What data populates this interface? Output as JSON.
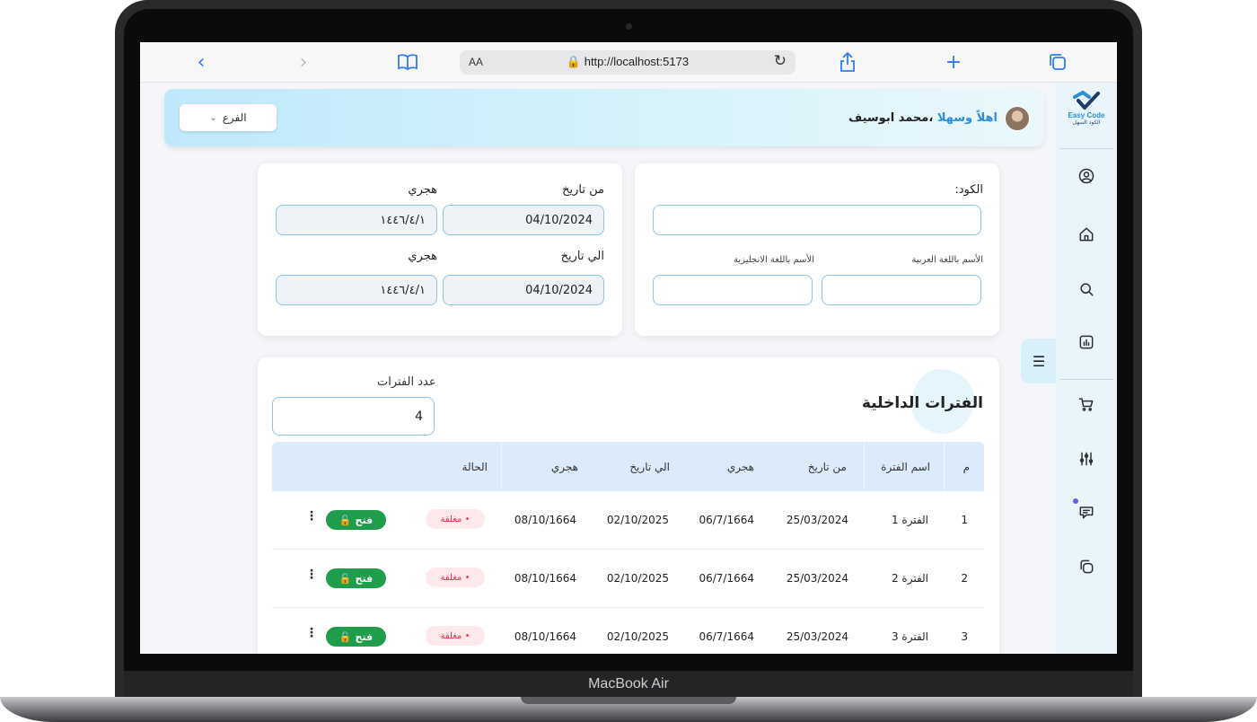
{
  "device": {
    "brand": "MacBook Air"
  },
  "browser": {
    "text_size_label": "AA",
    "url": "http://localhost:5173"
  },
  "app": {
    "logo": {
      "name": "Easy Code",
      "tagline": "الكود السهل"
    }
  },
  "header": {
    "welcome": "اهلاً وسهلا",
    "user_name": "،محمد ابوسيف",
    "branch_label": "الفرع"
  },
  "form": {
    "code_label": "الكود:",
    "code_value": "",
    "name_ar_label": "الأسم باللغة العربية",
    "name_en_label": "الأسم باللغة الانجليزية",
    "from_date_label": "من تاريخ",
    "from_date_value": "04/10/2024",
    "from_hijri_label": "هجري",
    "from_hijri_value": "١٤٤٦/٤/١",
    "to_date_label": "الي تاريخ",
    "to_date_value": "04/10/2024",
    "to_hijri_label": "هجري",
    "to_hijri_value": "١٤٤٦/٤/١"
  },
  "periods": {
    "title": "الفترات الداخلية",
    "count_label": "عدد الفترات",
    "count_value": "4",
    "columns": {
      "index": "م",
      "name": "اسم الفترة",
      "from_date": "من تاريخ",
      "from_hijri": "هجري",
      "to_date": "الي تاريخ",
      "to_hijri": "هجري",
      "status": "الحالة"
    },
    "rows": [
      {
        "index": "1",
        "name": "الفترة 1",
        "from_date": "25/03/2024",
        "from_hijri": "06/7/1664",
        "to_date": "02/10/2025",
        "to_hijri": "08/10/1664",
        "status": "• مغلقة",
        "action": "فتح"
      },
      {
        "index": "2",
        "name": "الفترة 2",
        "from_date": "25/03/2024",
        "from_hijri": "06/7/1664",
        "to_date": "02/10/2025",
        "to_hijri": "08/10/1664",
        "status": "• مغلقة",
        "action": "فتح"
      },
      {
        "index": "3",
        "name": "الفترة 3",
        "from_date": "25/03/2024",
        "from_hijri": "06/7/1664",
        "to_date": "02/10/2025",
        "to_hijri": "08/10/1664",
        "status": "• مغلقة",
        "action": "فتح"
      }
    ]
  },
  "colors": {
    "accent": "#2f8fd6",
    "open_button": "#1f9d4c",
    "closed_badge_text": "#e0364a",
    "table_header": "#dcebfb",
    "sidebar": "#e9f5fb"
  }
}
